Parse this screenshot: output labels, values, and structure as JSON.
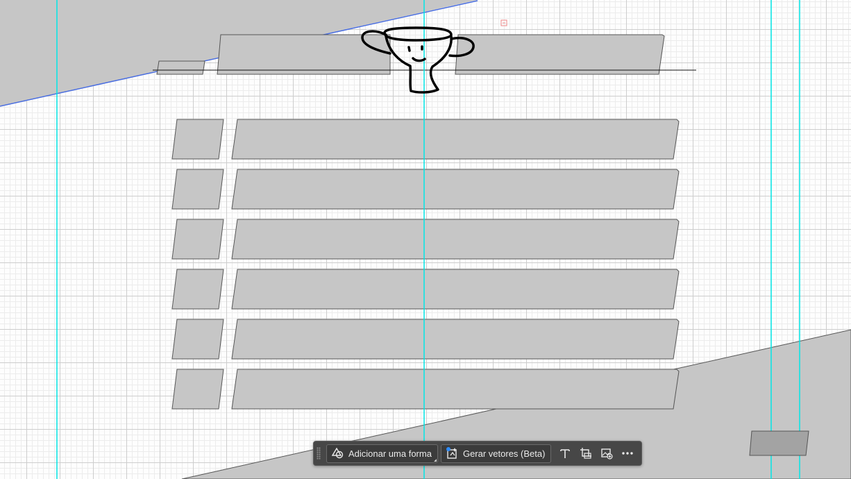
{
  "colors": {
    "canvas_bg": "#fdfdfd",
    "shape_fill": "#c6c6c6",
    "shape_fill_dark": "#a3a3a3",
    "shape_stroke": "#555555",
    "guide": "#00e5e5",
    "selection_line": "#4a6ee0",
    "toolbar_bg": "#474747"
  },
  "contextual_taskbar": {
    "add_shape_label": "Adicionar uma forma",
    "add_shape_icon": "shapes-icon",
    "generate_vectors_label": "Gerar vetores (Beta)",
    "generate_vectors_icon": "generate-vectors-icon",
    "text_icon": "text-tool-icon",
    "crop_icon": "crop-artboard-icon",
    "image_icon": "place-image-icon",
    "more_icon": "more-options-icon"
  },
  "canvas": {
    "doodle_name": "trophy-cup-doodle",
    "table_rows": 6
  }
}
